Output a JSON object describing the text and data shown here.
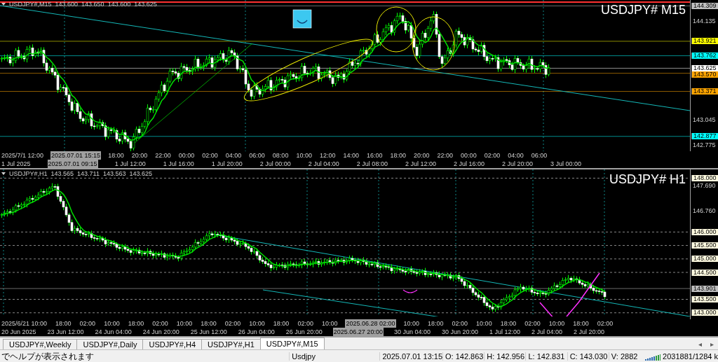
{
  "charts": [
    {
      "header": {
        "symbol": "USDJPY#,M15",
        "ohlc": [
          "143.600",
          "143.650",
          "143.600",
          "143.625"
        ]
      },
      "big_label": "USDJPY# M15",
      "price_ticks": [
        "144.135",
        "143.045",
        "142.775"
      ],
      "price_tags": [
        {
          "text": "144.309",
          "color": "#c0c0c0",
          "kind": "line"
        },
        {
          "text": "143.921",
          "color": "#ffff00",
          "kind": "line"
        },
        {
          "text": "143.762",
          "color": "#00ffff",
          "kind": "line"
        },
        {
          "text": "143.625",
          "color": "#ffffff",
          "kind": "line"
        },
        {
          "text": "143.570",
          "color": "#ffa500",
          "kind": "line"
        },
        {
          "text": "143.371",
          "color": "#ffa500",
          "kind": "line"
        },
        {
          "text": "142.877",
          "color": "#00ffff",
          "kind": "line"
        }
      ],
      "time_rows": [
        [
          {
            "text": "2025/7/1 12:00",
            "highlighted": false
          },
          {
            "text": "2025.07.01 15:15",
            "highlighted": true
          },
          {
            "text": "18:00",
            "highlighted": false
          },
          {
            "text": "20:00",
            "highlighted": false
          },
          {
            "text": "22:00",
            "highlighted": false
          },
          {
            "text": "00:00",
            "highlighted": false
          },
          {
            "text": "02:00",
            "highlighted": false
          },
          {
            "text": "04:00",
            "highlighted": false
          },
          {
            "text": "06:00",
            "highlighted": false
          },
          {
            "text": "08:00",
            "highlighted": false
          },
          {
            "text": "10:00",
            "highlighted": false
          },
          {
            "text": "12:00",
            "highlighted": false
          },
          {
            "text": "14:00",
            "highlighted": false
          },
          {
            "text": "16:00",
            "highlighted": false
          },
          {
            "text": "18:00",
            "highlighted": false
          },
          {
            "text": "20:00",
            "highlighted": false
          },
          {
            "text": "22:00",
            "highlighted": false
          },
          {
            "text": "00:00",
            "highlighted": false
          },
          {
            "text": "02:00",
            "highlighted": false
          },
          {
            "text": "04:00",
            "highlighted": false
          },
          {
            "text": "06:00",
            "highlighted": false
          }
        ],
        [
          {
            "text": "1 Jul 2025",
            "highlighted": false
          },
          {
            "text": "2025.07.01 09:15",
            "highlighted": true
          },
          {
            "text": "1 Jul 12:00",
            "highlighted": false
          },
          {
            "text": "1 Jul 16:00",
            "highlighted": false
          },
          {
            "text": "1 Jul 20:00",
            "highlighted": false
          },
          {
            "text": "2 Jul 00:00",
            "highlighted": false
          },
          {
            "text": "2 Jul 04:00",
            "highlighted": false
          },
          {
            "text": "2 Jul 08:00",
            "highlighted": false
          },
          {
            "text": "2 Jul 12:00",
            "highlighted": false
          },
          {
            "text": "2 Jul 16:00",
            "highlighted": false
          },
          {
            "text": "2 Jul 20:00",
            "highlighted": false
          },
          {
            "text": "3 Jul 00:00",
            "highlighted": false
          }
        ]
      ]
    },
    {
      "header": {
        "symbol": "USDJPY#,H1",
        "ohlc": [
          "143.565",
          "143.711",
          "143.563",
          "143.625"
        ]
      },
      "big_label": "USDJPY# H1",
      "price_ticks": [
        "147.690",
        "146.760"
      ],
      "price_tags": [
        {
          "text": "148.000",
          "color": "#fffbe0",
          "kind": "level"
        },
        {
          "text": "146.000",
          "color": "#fffbe0",
          "kind": "level"
        },
        {
          "text": "145.500",
          "color": "#fffbe0",
          "kind": "level"
        },
        {
          "text": "145.000",
          "color": "#fffbe0",
          "kind": "level"
        },
        {
          "text": "144.500",
          "color": "#fffbe0",
          "kind": "level"
        },
        {
          "text": "143.901",
          "color": "#c0c0c0",
          "kind": "line"
        },
        {
          "text": "143.500",
          "color": "#fffbe0",
          "kind": "level"
        },
        {
          "text": "143.000",
          "color": "#fffbe0",
          "kind": "level"
        }
      ],
      "time_rows": [
        [
          {
            "text": "2025/6/21 10:00",
            "highlighted": false
          },
          {
            "text": "18:00",
            "highlighted": false
          },
          {
            "text": "02:00",
            "highlighted": false
          },
          {
            "text": "10:00",
            "highlighted": false
          },
          {
            "text": "18:00",
            "highlighted": false
          },
          {
            "text": "02:00",
            "highlighted": false
          },
          {
            "text": "10:00",
            "highlighted": false
          },
          {
            "text": "18:00",
            "highlighted": false
          },
          {
            "text": "02:00",
            "highlighted": false
          },
          {
            "text": "10:00",
            "highlighted": false
          },
          {
            "text": "18:00",
            "highlighted": false
          },
          {
            "text": "02:00",
            "highlighted": false
          },
          {
            "text": "10:00",
            "highlighted": false
          },
          {
            "text": "2025.06.28 02:00",
            "highlighted": true
          },
          {
            "text": "10:00",
            "highlighted": false
          },
          {
            "text": "18:00",
            "highlighted": false
          },
          {
            "text": "02:00",
            "highlighted": false
          },
          {
            "text": "10:00",
            "highlighted": false
          },
          {
            "text": "18:00",
            "highlighted": false
          },
          {
            "text": "02:00",
            "highlighted": false
          },
          {
            "text": "10:00",
            "highlighted": false
          },
          {
            "text": "18:00",
            "highlighted": false
          },
          {
            "text": "02:00",
            "highlighted": false
          }
        ],
        [
          {
            "text": "20 Jun 2025",
            "highlighted": false
          },
          {
            "text": "23 Jun 12:00",
            "highlighted": false
          },
          {
            "text": "24 Jun 04:00",
            "highlighted": false
          },
          {
            "text": "24 Jun 20:00",
            "highlighted": false
          },
          {
            "text": "25 Jun 12:00",
            "highlighted": false
          },
          {
            "text": "26 Jun 04:00",
            "highlighted": false
          },
          {
            "text": "26 Jun 20:00",
            "highlighted": false
          },
          {
            "text": "2025.06.27 20:00",
            "highlighted": true
          },
          {
            "text": "30 Jun 04:00",
            "highlighted": false
          },
          {
            "text": "30 Jun 20:00",
            "highlighted": false
          },
          {
            "text": "1 Jul 12:00",
            "highlighted": false
          },
          {
            "text": "2 Jul 04:00",
            "highlighted": false
          },
          {
            "text": "2 Jul 20:00",
            "highlighted": false
          }
        ]
      ]
    }
  ],
  "tabs": [
    {
      "label": "USDJPY#,Weekly",
      "selected": false
    },
    {
      "label": "USDJPY#,Daily",
      "selected": false
    },
    {
      "label": "USDJPY#,H4",
      "selected": false
    },
    {
      "label": "USDJPY#,H1",
      "selected": false
    },
    {
      "label": "USDJPY#,M15",
      "selected": true
    }
  ],
  "tab_scroll": [
    "◂",
    "▸"
  ],
  "status_bar": {
    "help": "でヘルプが表示されます",
    "profile": "Usdjpy",
    "time": "2025.07.01 13:15",
    "open": "O: 142.863",
    "high": "H: 142.956",
    "low": "L: 142.831",
    "close": "C: 143.030",
    "volume": "V: 2882",
    "traffic": "2031881/1284 k"
  }
}
